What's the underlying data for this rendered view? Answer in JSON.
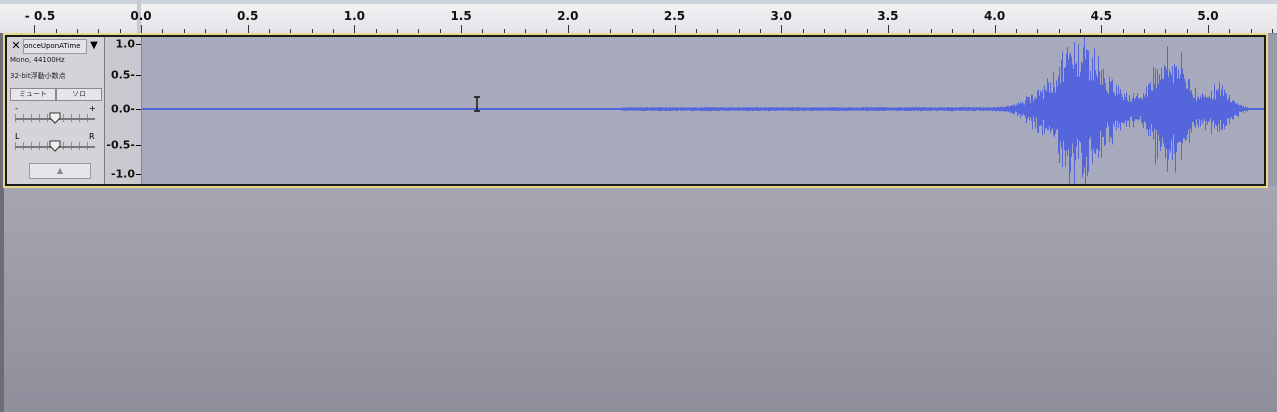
{
  "ruler": {
    "labels": [
      "- 0.5",
      "0.0",
      "0.5",
      "1.0",
      "1.5",
      "2.0",
      "2.5",
      "3.0",
      "3.5",
      "4.0",
      "4.5",
      "5.0"
    ]
  },
  "track": {
    "name": "onceUponATime",
    "format": "Mono, 44100Hz",
    "bit_depth": "32-bit浮動小数点",
    "mute_label": "ミュート",
    "solo_label": "ソロ",
    "gain_minus": "-",
    "gain_plus": "+",
    "pan_left": "L",
    "pan_right": "R",
    "close_glyph": "✕",
    "menu_glyph": "▼",
    "collapse_glyph": "▲",
    "amplitude_labels": [
      "1.0",
      "0.5-",
      "0.0-",
      "-0.5-",
      "-1.0"
    ],
    "gain_level": 0.5,
    "pan_level": 0.5
  },
  "colors": {
    "waveform": "#5566dd",
    "track_background": "#c4c4cc",
    "selected_border": "#e6d98a"
  },
  "icons": [
    "close-icon",
    "dropdown-arrow-icon",
    "collapse-arrow-icon",
    "ibeam-cursor-icon"
  ]
}
